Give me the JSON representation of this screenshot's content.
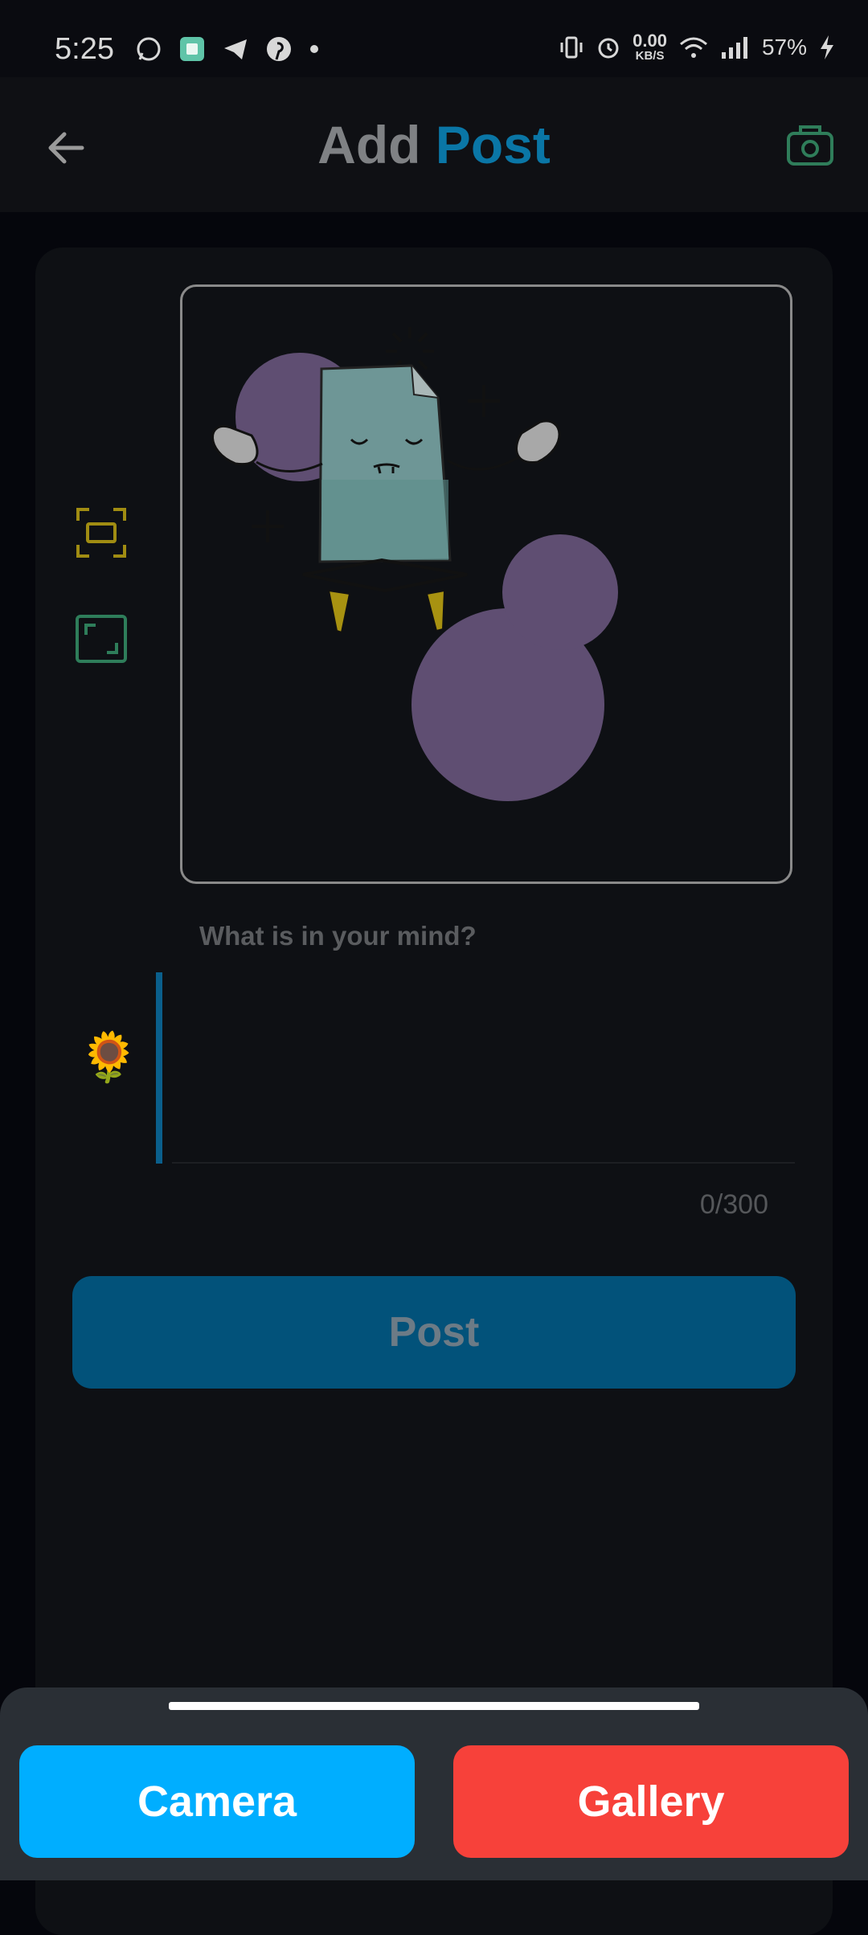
{
  "status_bar": {
    "time": "5:25",
    "net_speed_value": "0.00",
    "net_speed_unit": "KB/S",
    "battery": "57%",
    "icons": [
      "whatsapp-icon",
      "app-icon",
      "telegram-icon",
      "pinterest-icon",
      "dot-icon",
      "vibrate-icon",
      "alarm-icon",
      "wifi-icon",
      "signal-icon",
      "charging-icon"
    ]
  },
  "appbar": {
    "title_word1": "Add",
    "title_word2": "Post",
    "back_icon": "arrow-left-icon",
    "camera_icon": "camera-icon"
  },
  "editor": {
    "placeholder": "What is in your mind?",
    "counter": "0/300",
    "post_label": "Post",
    "emoji": "🌻",
    "tools": [
      "crop-icon",
      "fullscreen-icon"
    ]
  },
  "sheet": {
    "camera_label": "Camera",
    "gallery_label": "Gallery"
  },
  "colors": {
    "accent_blue": "#0a76a6",
    "post_button": "#02527a",
    "camera_button": "#00aeff",
    "gallery_button": "#f7413a",
    "crop_icon": "#a08c12",
    "fullscreen_icon": "#2e7d5a"
  }
}
